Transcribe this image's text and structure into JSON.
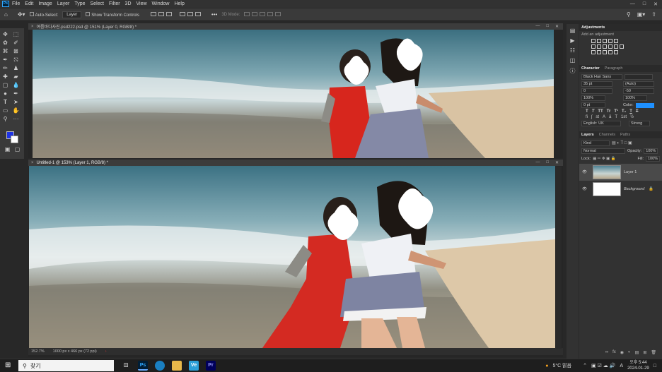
{
  "menubar": {
    "logo": "Ps",
    "items": [
      "File",
      "Edit",
      "Image",
      "Layer",
      "Type",
      "Select",
      "Filter",
      "3D",
      "View",
      "Window",
      "Help"
    ]
  },
  "options": {
    "auto_select_label": "Auto-Select:",
    "auto_select_value": "Layer",
    "transform_label": "Show Transform Controls",
    "mode_3d_label": "3D Mode:"
  },
  "colors": {
    "foreground": "#1e33e6",
    "background": "#ffffff",
    "accent": "#31a8ff"
  },
  "doc1": {
    "title": "여름바다사진.psd222.psd @ 151% (Layer 0, RGB/8) *"
  },
  "doc2": {
    "title": "Untitled-1 @ 153% (Layer 1, RGB/8) *",
    "zoom": "152.7%",
    "doc_info": "1000 px x 466 px (72 ppi)"
  },
  "adjustments": {
    "tab": "Adjustments",
    "hint": "Add an adjustment"
  },
  "character": {
    "tabs": [
      "Character",
      "Paragraph"
    ],
    "font_family": "Black Han Sans",
    "font_size": "35 pt",
    "leading": "(Auto)",
    "kerning": "0",
    "tracking": "-50",
    "vert_scale": "100%",
    "horiz_scale": "100%",
    "baseline": "0 pt",
    "color_label": "Color:",
    "language": "English: UK",
    "antialias": "Strong",
    "type_buttons": [
      "T",
      "T",
      "TT",
      "Tr",
      "T¹",
      "T₁",
      "T",
      "T"
    ]
  },
  "layers": {
    "tabs": [
      "Layers",
      "Channels",
      "Paths"
    ],
    "filter": "Kind",
    "blend_mode": "Normal",
    "opacity_label": "Opacity:",
    "opacity": "100%",
    "lock_label": "Lock:",
    "fill_label": "Fill:",
    "fill": "100%",
    "items": [
      {
        "name": "Layer 1"
      },
      {
        "name": "Background"
      }
    ]
  },
  "taskbar": {
    "search_placeholder": "찾기",
    "weather": "5°C 맑음",
    "ime": "A",
    "time": "오후 5:44",
    "date": "2024-01-29",
    "apps": [
      "Ps",
      "Ve",
      "Pr"
    ]
  }
}
